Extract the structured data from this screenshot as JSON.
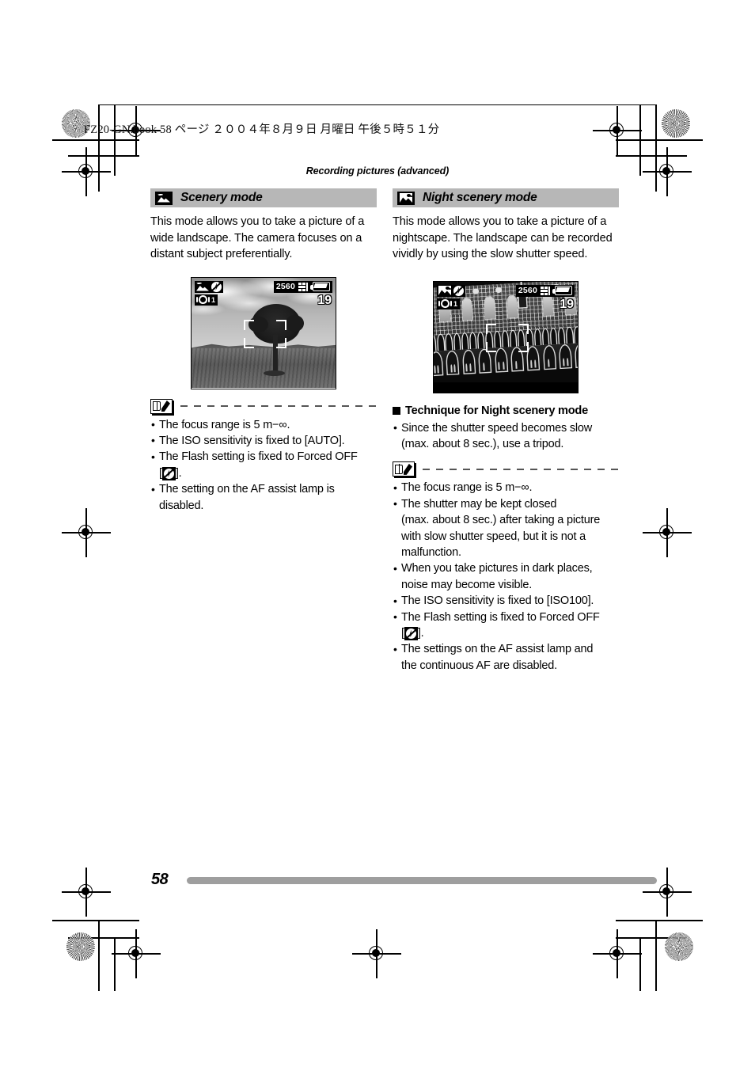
{
  "print_header": {
    "text": "FZ20-GN.book   58 ページ   ２００４年８月９日   月曜日   午後５時５１分"
  },
  "running_head": "Recording pictures (advanced)",
  "left_column": {
    "icon": "scenery-mode-icon",
    "title": "Scenery mode",
    "intro": "This mode allows you to take a picture of a wide landscape. The camera focuses on a distant subject preferentially.",
    "lcd": {
      "mode_icon": "scenery-mode-icon",
      "flash_icon": "flash-forced-off-icon",
      "ois_icon": "optical-image-stabilizer-icon",
      "ois_value": "1",
      "resolution": "2560",
      "quality_icon": "quality-fine-icon",
      "battery_icon": "battery-full-icon",
      "remaining_shots": "19",
      "af_frame": "af-area-frame"
    },
    "note_icon": "memo-note-icon",
    "notes": [
      "The focus range is 5 m−∞.",
      "The ISO sensitivity is fixed to [AUTO].",
      "The Flash setting is fixed to Forced OFF",
      "The setting on the AF assist lamp is",
      "disabled."
    ],
    "note_flash_prefix": "[",
    "note_flash_suffix": "].",
    "note_flash_icon": "flash-forced-off-icon"
  },
  "right_column": {
    "icon": "night-scenery-mode-icon",
    "title": "Night scenery mode",
    "intro": "This mode allows you to take a picture of a nightscape. The landscape can be recorded vividly by using the slow shutter speed.",
    "lcd": {
      "mode_icon": "night-scenery-mode-icon",
      "flash_icon": "flash-forced-off-icon",
      "ois_icon": "optical-image-stabilizer-icon",
      "ois_value": "1",
      "resolution": "2560",
      "quality_icon": "quality-fine-icon",
      "battery_icon": "battery-full-icon",
      "remaining_shots": "19",
      "af_frame": "af-area-frame"
    },
    "technique_heading": "Technique for Night scenery mode",
    "technique_notes": [
      "Since the shutter speed becomes slow",
      "(max. about 8 sec.), use a tripod."
    ],
    "note_icon": "memo-note-icon",
    "notes": [
      "The focus range is 5 m−∞.",
      "The shutter may be kept closed",
      "(max. about 8 sec.) after taking a picture",
      "with slow shutter speed, but it is not a",
      "malfunction.",
      "When you take pictures in dark places,",
      "noise may become visible.",
      "The ISO sensitivity is fixed to [ISO100].",
      "The Flash setting is fixed to Forced OFF",
      "The settings on the AF assist lamp and",
      "the continuous AF are disabled."
    ],
    "note_flash_prefix": "[",
    "note_flash_suffix": "].",
    "note_flash_icon": "flash-forced-off-icon"
  },
  "footer": {
    "page_number": "58"
  },
  "colors": {
    "section_bar": "#b7b7b7",
    "folio_rule": "#9e9e9e",
    "text": "#000000",
    "page_background": "#ffffff"
  }
}
